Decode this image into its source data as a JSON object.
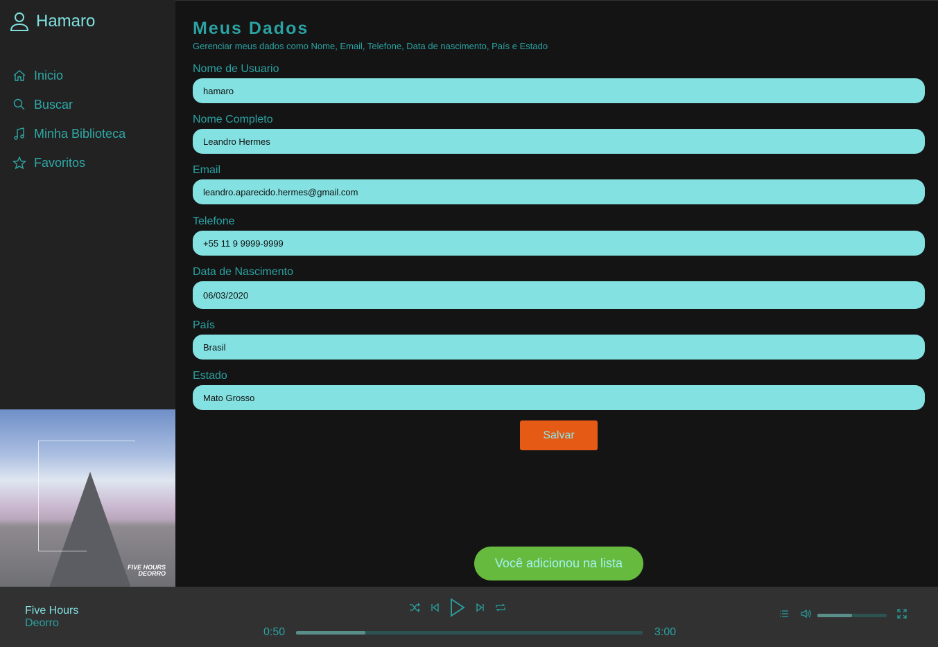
{
  "sidebar": {
    "brand": "Hamaro",
    "items": [
      {
        "label": "Inicio",
        "icon": "home-icon"
      },
      {
        "label": "Buscar",
        "icon": "search-icon"
      },
      {
        "label": "Minha Biblioteca",
        "icon": "music-note-icon"
      },
      {
        "label": "Favoritos",
        "icon": "star-icon"
      }
    ],
    "album_art": {
      "caption_line1": "FIVE HOURS",
      "caption_line2": "DEORRO"
    }
  },
  "main": {
    "title": "Meus Dados",
    "subtitle": "Gerenciar meus dados como Nome, Email, Telefone, Data de nascimento, País e Estado",
    "fields": [
      {
        "label": "Nome de Usuario",
        "value": "hamaro"
      },
      {
        "label": "Nome Completo",
        "value": "Leandro Hermes"
      },
      {
        "label": "Email",
        "value": "leandro.aparecido.hermes@gmail.com"
      },
      {
        "label": "Telefone",
        "value": "+55 11 9 9999-9999"
      },
      {
        "label": "Data de Nascimento",
        "value": "06/03/2020"
      },
      {
        "label": "País",
        "value": "Brasil"
      },
      {
        "label": "Estado",
        "value": "Mato Grosso"
      }
    ],
    "save_label": "Salvar",
    "toast": "Você adicionou na lista"
  },
  "player": {
    "title": "Five Hours",
    "artist": "Deorro",
    "current_time": "0:50",
    "duration": "3:00",
    "progress_fraction": 0.2,
    "volume_fraction": 0.5
  },
  "colors": {
    "accent": "#2aa3a2",
    "input_bg": "#84e1e1",
    "save": "#e55a15",
    "toast": "#66bb3e"
  }
}
